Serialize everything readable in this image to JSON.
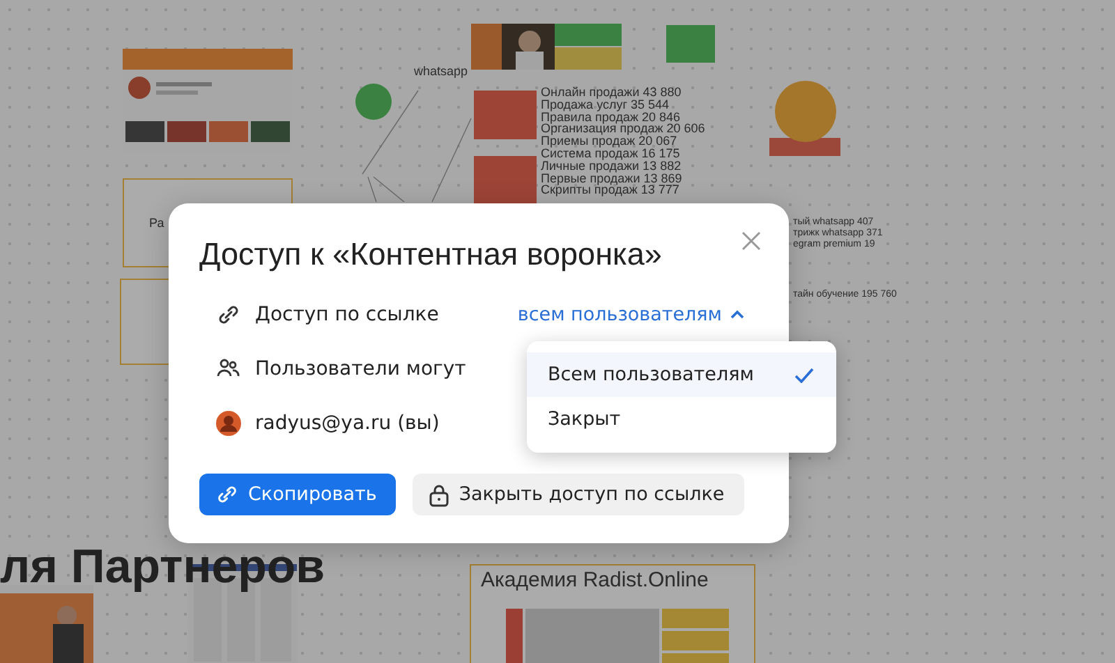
{
  "board": {
    "labels": [
      {
        "kind": "note",
        "text": "whatsapp"
      },
      {
        "kind": "note",
        "text": "Ра"
      },
      {
        "kind": "heading",
        "text": "ля Партнеров"
      },
      {
        "kind": "title",
        "text": "Академия Radist.Online"
      }
    ],
    "stats": [
      "Онлайн продажи 43 880",
      "Продажа услуг 35 544",
      "Правила продаж 20 846",
      "Организация продаж 20 606",
      "Приемы продаж 20 067",
      "Система продаж 16 175",
      "Личные продажи 13 882",
      "Первые продажи 13 869",
      "Скрипты продаж 13 777"
    ],
    "side_stats": [
      "тый whatsapp 407",
      "трижк whatsapp 371",
      "egram premium 19",
      "тайн обучение 195 760"
    ]
  },
  "dialog": {
    "title": "Доступ к «Контентная воронка»",
    "rows": [
      {
        "kind": "link",
        "label": "Доступ по ссылке",
        "value": "всем пользователям",
        "expanded": true
      },
      {
        "kind": "users",
        "label": "Пользователи могут"
      },
      {
        "kind": "person",
        "label": "radyus@ya.ru (вы)"
      }
    ],
    "buttons": [
      {
        "kind": "primary",
        "label": "Скопировать"
      },
      {
        "kind": "lock",
        "label": "Закрыть доступ по ссылке"
      }
    ]
  },
  "menu": {
    "items": [
      {
        "label": "Всем пользователям",
        "selected": true
      },
      {
        "label": "Закрыт",
        "selected": false
      }
    ]
  }
}
